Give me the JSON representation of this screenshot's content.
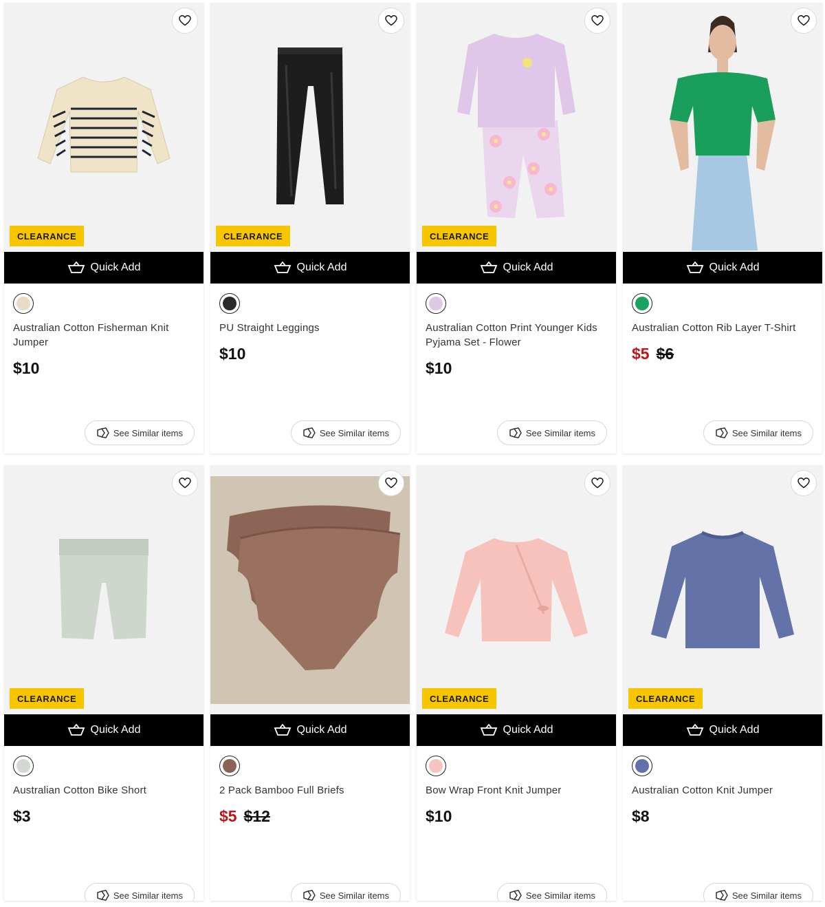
{
  "ui": {
    "quick_add_label": "Quick Add",
    "see_similar_label": "See Similar items",
    "clearance_label": "CLEARANCE"
  },
  "colors": {
    "badge": "#f7c600",
    "sale_price": "#c0141b",
    "quick_add_bg": "#000000"
  },
  "products": [
    {
      "name": "Australian Cotton Fisherman Knit Jumper",
      "price": "$10",
      "sale_price": null,
      "was_price": null,
      "clearance": true,
      "image": "striped-jumper",
      "swatch": "#e8dcc4"
    },
    {
      "name": "PU Straight Leggings",
      "price": "$10",
      "sale_price": null,
      "was_price": null,
      "clearance": true,
      "image": "black-leggings",
      "swatch": "#2a2a2a"
    },
    {
      "name": "Australian Cotton Print Younger Kids Pyjama Set - Flower",
      "price": "$10",
      "sale_price": null,
      "was_price": null,
      "clearance": true,
      "image": "lilac-pyjamas",
      "swatch": "#ddc8e6"
    },
    {
      "name": "Australian Cotton Rib Layer T-Shirt",
      "price": null,
      "sale_price": "$5",
      "was_price": "$6",
      "clearance": false,
      "image": "green-tshirt-model",
      "swatch": "#1aa35e"
    },
    {
      "name": "Australian Cotton Bike Short",
      "price": "$3",
      "sale_price": null,
      "was_price": null,
      "clearance": true,
      "image": "grey-bike-short",
      "swatch": "#d4d8d2"
    },
    {
      "name": "2 Pack Bamboo Full Briefs",
      "price": null,
      "sale_price": "$5",
      "was_price": "$12",
      "clearance": false,
      "image": "brown-briefs",
      "swatch": "#8a6355"
    },
    {
      "name": "Bow Wrap Front Knit Jumper",
      "price": "$10",
      "sale_price": null,
      "was_price": null,
      "clearance": true,
      "image": "pink-jumper",
      "swatch": "#f6c4c0"
    },
    {
      "name": "Australian Cotton Knit Jumper",
      "price": "$8",
      "sale_price": null,
      "was_price": null,
      "clearance": true,
      "image": "blue-jumper",
      "swatch": "#6272a8"
    }
  ]
}
